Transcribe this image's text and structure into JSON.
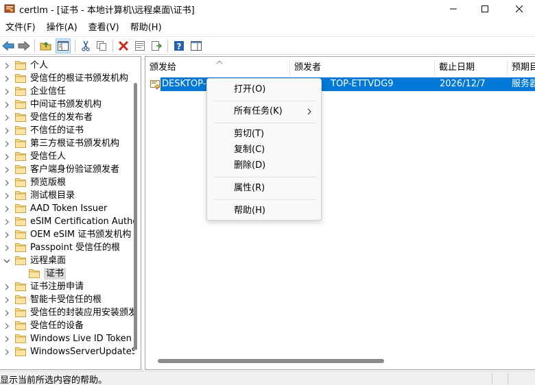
{
  "window": {
    "title": "certlm - [证书 - 本地计算机\\远程桌面\\证书]",
    "icon": "certlm-app-icon",
    "controls": [
      "minimize-icon",
      "maximize-icon",
      "close-icon"
    ]
  },
  "menubar": {
    "items": [
      {
        "label": "文件(F)"
      },
      {
        "label": "操作(A)"
      },
      {
        "label": "查看(V)"
      },
      {
        "label": "帮助(H)"
      }
    ]
  },
  "toolbar": {
    "buttons": [
      "back-arrow-icon",
      "forward-arrow-icon",
      "up-folder-icon",
      "show-hide-tree-icon",
      "cut-icon",
      "copy-icon",
      "delete-icon",
      "properties-icon",
      "export-list-icon",
      "help-icon",
      "action-pane-icon"
    ]
  },
  "tree": {
    "items": [
      {
        "label": "个人",
        "expanded": false
      },
      {
        "label": "受信任的根证书颁发机构",
        "expanded": false
      },
      {
        "label": "企业信任",
        "expanded": false
      },
      {
        "label": "中间证书颁发机构",
        "expanded": false
      },
      {
        "label": "受信任的发布者",
        "expanded": false
      },
      {
        "label": "不信任的证书",
        "expanded": false
      },
      {
        "label": "第三方根证书颁发机构",
        "expanded": false
      },
      {
        "label": "受信任人",
        "expanded": false
      },
      {
        "label": "客户端身份验证颁发者",
        "expanded": false
      },
      {
        "label": "预览版根",
        "expanded": false
      },
      {
        "label": "测试根目录",
        "expanded": false
      },
      {
        "label": "AAD Token Issuer",
        "expanded": false
      },
      {
        "label": "eSIM Certification Author",
        "expanded": false
      },
      {
        "label": "OEM eSIM 证书颁发机构",
        "expanded": false
      },
      {
        "label": "Passpoint 受信任的根",
        "expanded": false
      },
      {
        "label": "远程桌面",
        "expanded": true
      },
      {
        "label": "证书",
        "child": true,
        "selected": true
      },
      {
        "label": "证书注册申请",
        "expanded": false
      },
      {
        "label": "智能卡受信任的根",
        "expanded": false
      },
      {
        "label": "受信任的封装应用安装颁发",
        "expanded": false
      },
      {
        "label": "受信任的设备",
        "expanded": false
      },
      {
        "label": "Windows Live ID Token Is",
        "expanded": false
      },
      {
        "label": "WindowsServerUpdateSe",
        "expanded": false
      }
    ]
  },
  "list": {
    "columns": [
      "颁发给",
      "颁发者",
      "截止日期",
      "预期目"
    ],
    "rows": [
      {
        "issued_to": "DESKTOP-E",
        "issued_by": "TOP-ETTVDG9",
        "expiration": "2026/12/7",
        "purpose": "服务器"
      }
    ],
    "selection_color": "#0078d7"
  },
  "context_menu": {
    "items": [
      {
        "label": "打开(O)"
      },
      {
        "label": "所有任务(K)",
        "submenu": true
      },
      {
        "label": "剪切(T)"
      },
      {
        "label": "复制(C)"
      },
      {
        "label": "删除(D)"
      },
      {
        "label": "属性(R)"
      },
      {
        "label": "帮助(H)"
      }
    ]
  },
  "statusbar": {
    "text": "显示当前所选内容的帮助。"
  }
}
